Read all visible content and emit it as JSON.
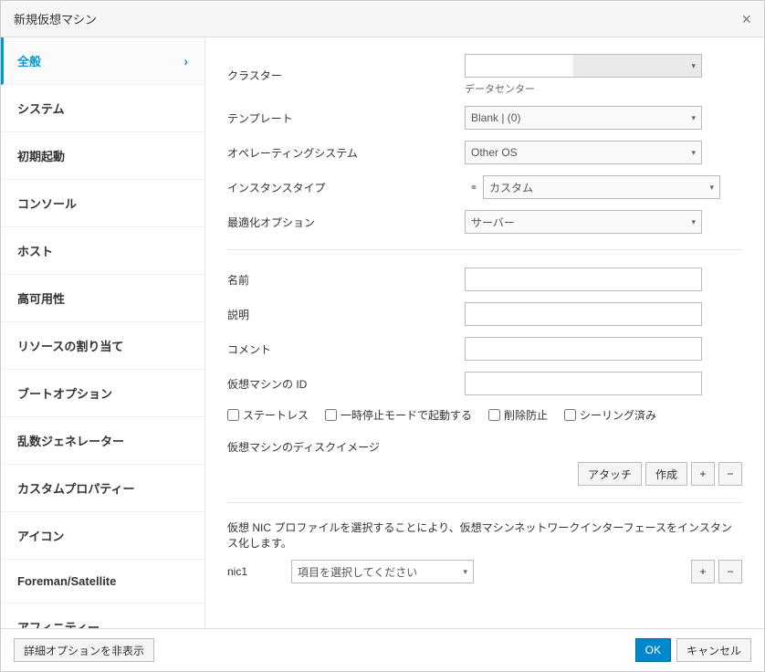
{
  "dialog": {
    "title": "新規仮想マシン",
    "close": "×"
  },
  "sidebar": {
    "items": [
      {
        "label": "全般",
        "active": true
      },
      {
        "label": "システム"
      },
      {
        "label": "初期起動"
      },
      {
        "label": "コンソール"
      },
      {
        "label": "ホスト"
      },
      {
        "label": "高可用性"
      },
      {
        "label": "リソースの割り当て"
      },
      {
        "label": "ブートオプション"
      },
      {
        "label": "乱数ジェネレーター"
      },
      {
        "label": "カスタムプロパティー"
      },
      {
        "label": "アイコン"
      },
      {
        "label": "Foreman/Satellite"
      },
      {
        "label": "アフィニティー"
      }
    ]
  },
  "form": {
    "cluster": {
      "label": "クラスター",
      "value": "",
      "sub": "データセンター"
    },
    "template": {
      "label": "テンプレート",
      "value": "Blank |  (0)"
    },
    "os": {
      "label": "オペレーティングシステム",
      "value": "Other OS"
    },
    "instance_type": {
      "label": "インスタンスタイプ",
      "value": "カスタム"
    },
    "optimize": {
      "label": "最適化オプション",
      "value": "サーバー"
    },
    "name": {
      "label": "名前",
      "value": ""
    },
    "description": {
      "label": "説明",
      "value": ""
    },
    "comment": {
      "label": "コメント",
      "value": ""
    },
    "vm_id": {
      "label": "仮想マシンの ID",
      "value": ""
    },
    "checkboxes": {
      "stateless": "ステートレス",
      "start_paused": "一時停止モードで起動する",
      "delete_protect": "削除防止",
      "sealed": "シーリング済み"
    },
    "disk_image_label": "仮想マシンのディスクイメージ",
    "attach_btn": "アタッチ",
    "create_btn": "作成",
    "nic_note": "仮想 NIC プロファイルを選択することにより、仮想マシンネットワークインターフェースをインスタンス化します。",
    "nic1_label": "nic1",
    "nic_select_placeholder": "項目を選択してください"
  },
  "footer": {
    "hide_advanced": "詳細オプションを非表示",
    "ok": "OK",
    "cancel": "キャンセル"
  }
}
